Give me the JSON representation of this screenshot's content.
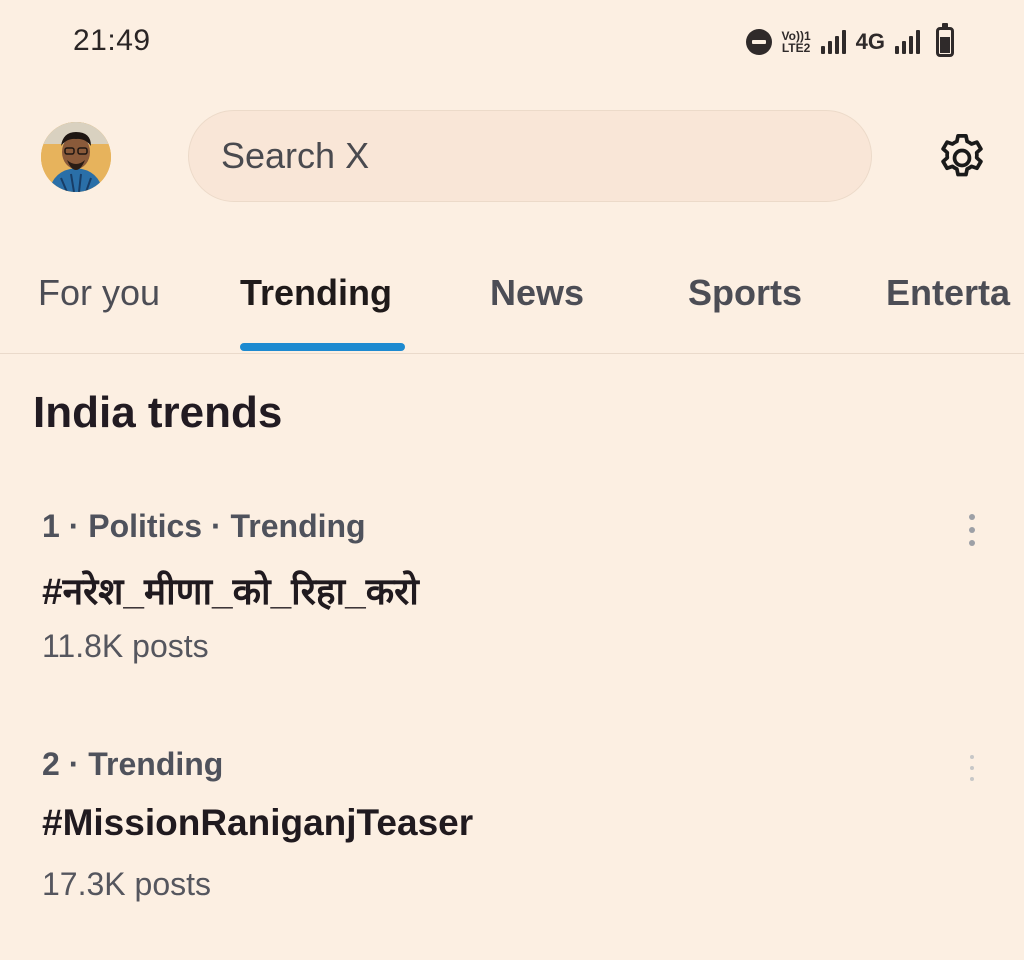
{
  "status_bar": {
    "time": "21:49",
    "volte_top": "Vo))1",
    "volte_bottom": "LTE2",
    "network": "4G",
    "icons": [
      "do-not-disturb-icon",
      "volte-icon",
      "signal-icon",
      "network-4g-icon",
      "signal-icon",
      "battery-icon"
    ]
  },
  "header": {
    "avatar_icon": "profile-avatar",
    "search_placeholder": "Search X",
    "settings_icon": "gear-icon"
  },
  "tabs": [
    {
      "label": "For you",
      "active": false
    },
    {
      "label": "Trending",
      "active": true
    },
    {
      "label": "News",
      "active": false
    },
    {
      "label": "Sports",
      "active": false
    },
    {
      "label": "Enterta",
      "active": false
    }
  ],
  "section": {
    "title": "India trends"
  },
  "trends": [
    {
      "meta": "1 · Politics · Trending",
      "title": "#नरेश_मीणा_को_रिहा_करो",
      "posts": "11.8K posts"
    },
    {
      "meta": "2 · Trending",
      "title": "#MissionRaniganjTeaser",
      "posts": "17.3K posts"
    }
  ],
  "colors": {
    "background": "#fcefe2",
    "accent": "#1d8ad0",
    "text_primary": "#1f1a1a",
    "text_secondary": "#4f525c"
  }
}
